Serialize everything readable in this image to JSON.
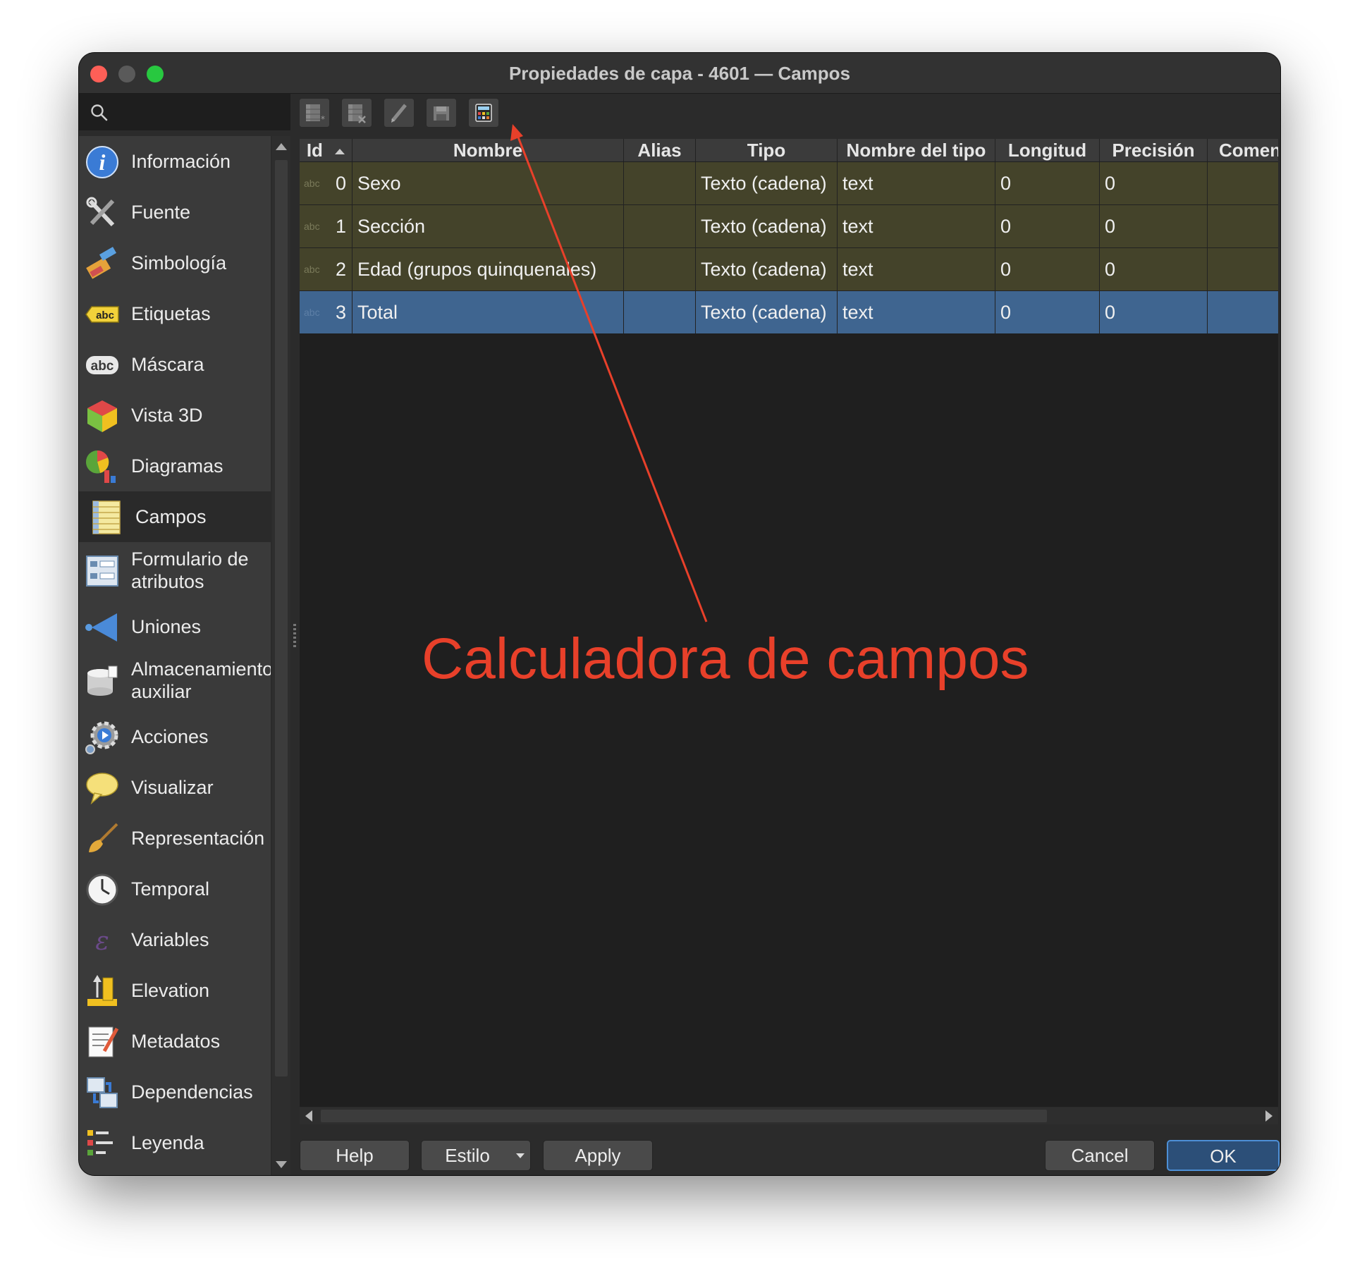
{
  "window": {
    "title": "Propiedades de capa - 4601 — Campos"
  },
  "search": {
    "placeholder": ""
  },
  "sidebar": {
    "items": [
      {
        "label": "Información",
        "icon": "info-icon"
      },
      {
        "label": "Fuente",
        "icon": "source-tools-icon"
      },
      {
        "label": "Simbología",
        "icon": "symbology-brush-icon"
      },
      {
        "label": "Etiquetas",
        "icon": "labels-abc-icon"
      },
      {
        "label": "Máscara",
        "icon": "mask-abc-icon"
      },
      {
        "label": "Vista 3D",
        "icon": "cube-3d-icon"
      },
      {
        "label": "Diagramas",
        "icon": "diagram-icon"
      },
      {
        "label": "Campos",
        "icon": "fields-table-icon",
        "active": true
      },
      {
        "label": "Formulario de atributos",
        "icon": "attribute-form-icon"
      },
      {
        "label": "Uniones",
        "icon": "joins-icon"
      },
      {
        "label": "Almacenamiento auxiliar",
        "icon": "auxiliary-storage-icon"
      },
      {
        "label": "Acciones",
        "icon": "actions-gear-icon"
      },
      {
        "label": "Visualizar",
        "icon": "display-balloon-icon"
      },
      {
        "label": "Representación",
        "icon": "rendering-brush-icon"
      },
      {
        "label": "Temporal",
        "icon": "clock-icon"
      },
      {
        "label": "Variables",
        "icon": "variables-icon"
      },
      {
        "label": "Elevation",
        "icon": "elevation-icon"
      },
      {
        "label": "Metadatos",
        "icon": "metadata-icon"
      },
      {
        "label": "Dependencias",
        "icon": "dependencies-icon"
      },
      {
        "label": "Leyenda",
        "icon": "legend-icon"
      }
    ]
  },
  "toolbar": {
    "buttons": [
      {
        "name": "new-field-button",
        "icon": "new-field-icon"
      },
      {
        "name": "delete-field-button",
        "icon": "delete-field-icon"
      },
      {
        "name": "toggle-editing-button",
        "icon": "pencil-icon"
      },
      {
        "name": "save-edits-button",
        "icon": "save-icon"
      },
      {
        "name": "field-calculator-button",
        "icon": "calculator-icon"
      }
    ]
  },
  "table": {
    "columns": [
      "Id",
      "Nombre",
      "Alias",
      "Tipo",
      "Nombre del tipo",
      "Longitud",
      "Precisión",
      "Comentario"
    ],
    "type_badge": "abc",
    "rows": [
      {
        "id": "0",
        "nombre": "Sexo",
        "alias": "",
        "tipo": "Texto (cadena)",
        "nombre_tipo": "text",
        "longitud": "0",
        "precision": "0",
        "comentario": ""
      },
      {
        "id": "1",
        "nombre": "Sección",
        "alias": "",
        "tipo": "Texto (cadena)",
        "nombre_tipo": "text",
        "longitud": "0",
        "precision": "0",
        "comentario": ""
      },
      {
        "id": "2",
        "nombre": "Edad (grupos quinquenales)",
        "alias": "",
        "tipo": "Texto (cadena)",
        "nombre_tipo": "text",
        "longitud": "0",
        "precision": "0",
        "comentario": ""
      },
      {
        "id": "3",
        "nombre": "Total",
        "alias": "",
        "tipo": "Texto (cadena)",
        "nombre_tipo": "text",
        "longitud": "0",
        "precision": "0",
        "comentario": "",
        "selected": true
      }
    ]
  },
  "buttons": {
    "help": "Help",
    "estilo": "Estilo",
    "apply": "Apply",
    "cancel": "Cancel",
    "ok": "OK"
  },
  "annotation": {
    "text": "Calculadora de campos",
    "color": "#e8402a"
  },
  "colors": {
    "row_odd": "#44432a",
    "row_selected": "#3f6590",
    "accent": "#4d8fd6"
  }
}
